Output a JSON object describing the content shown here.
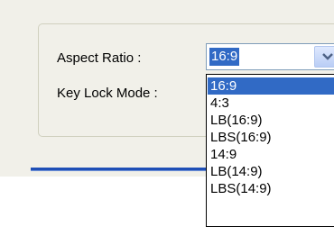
{
  "form": {
    "aspect_ratio_label": "Aspect Ratio :",
    "key_lock_mode_label": "Key Lock Mode :"
  },
  "aspect_ratio_combo": {
    "selected_value": "16:9",
    "options": [
      "16:9",
      "4:3",
      "LB(16:9)",
      "LBS(16:9)",
      "14:9",
      "LB(14:9)",
      "LBS(14:9)"
    ]
  },
  "colors": {
    "selection": "#316ac5",
    "panel_background": "#f1f0e9"
  }
}
